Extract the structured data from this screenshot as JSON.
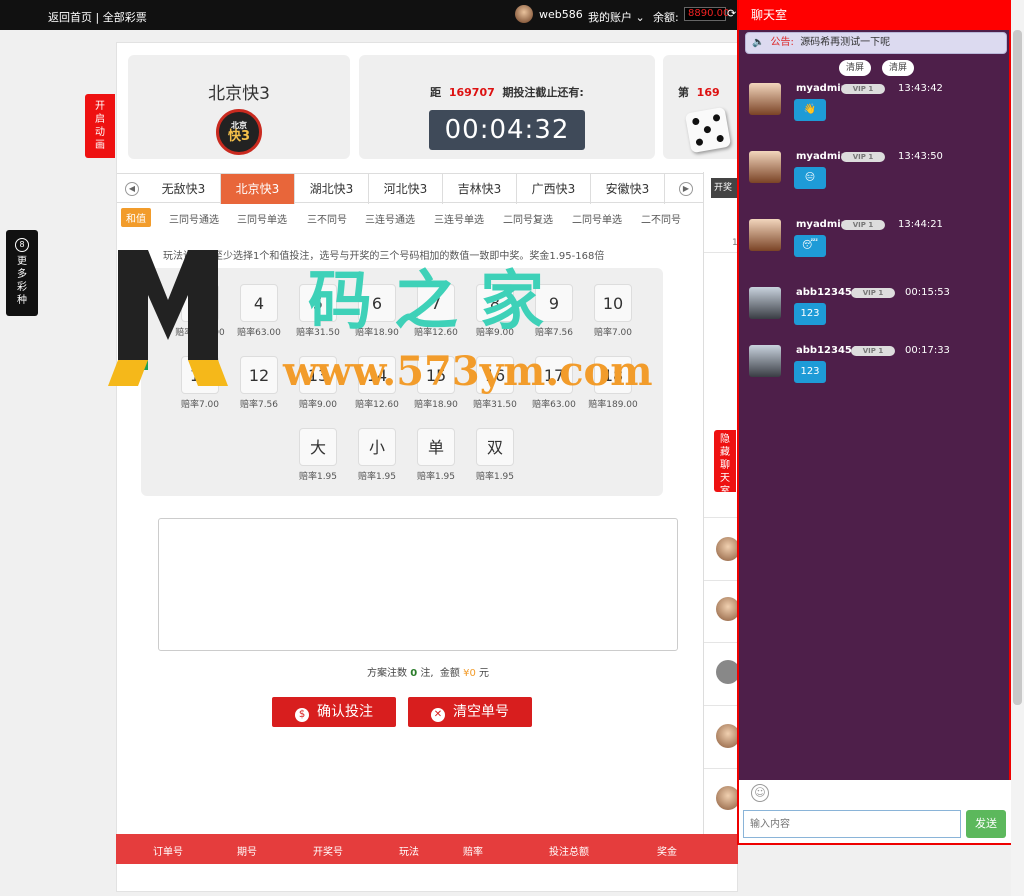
{
  "topbar": {
    "home": "返回首页",
    "all": "全部彩票",
    "user": "web586",
    "account": "我的账户",
    "balance_label": "余额:",
    "balance": "8890.00"
  },
  "sidebar": {
    "more_icon": "8",
    "more": "更多彩种",
    "open_anim": "开启动画",
    "hide_chat": "隐藏聊天室"
  },
  "game": {
    "name": "北京快3",
    "logo_top": "北京",
    "logo_bottom": "快3",
    "period_prefix": "距",
    "period": "169707",
    "period_suffix": "期投注截止还有:",
    "timer": "00:04:32",
    "next_prefix": "第",
    "next_period": "169"
  },
  "tabs": [
    "无敌快3",
    "北京快3",
    "湖北快3",
    "河北快3",
    "吉林快3",
    "广西快3",
    "安徽快3"
  ],
  "subtabs": [
    "和值",
    "三同号通选",
    "三同号单选",
    "三不同号",
    "三连号通选",
    "三连号单选",
    "二同号复选",
    "二同号单选",
    "二不同号"
  ],
  "description": "玩法说明：至少选择1个和值投注，选号与开奖的三个号码相加的数值一致即中奖。奖金1.95-168倍",
  "numbers_row1": [
    {
      "n": "3",
      "o": "赔率189.00"
    },
    {
      "n": "4",
      "o": "赔率63.00"
    },
    {
      "n": "5",
      "o": "赔率31.50"
    },
    {
      "n": "6",
      "o": "赔率18.90"
    },
    {
      "n": "7",
      "o": "赔率12.60"
    },
    {
      "n": "8",
      "o": "赔率9.00"
    },
    {
      "n": "9",
      "o": "赔率7.56"
    },
    {
      "n": "10",
      "o": "赔率7.00"
    }
  ],
  "numbers_row2": [
    {
      "n": "11",
      "o": "赔率7.00"
    },
    {
      "n": "12",
      "o": "赔率7.56"
    },
    {
      "n": "13",
      "o": "赔率9.00"
    },
    {
      "n": "14",
      "o": "赔率12.60"
    },
    {
      "n": "15",
      "o": "赔率18.90"
    },
    {
      "n": "16",
      "o": "赔率31.50"
    },
    {
      "n": "17",
      "o": "赔率63.00"
    },
    {
      "n": "18",
      "o": "赔率189.00"
    }
  ],
  "numbers_row3": [
    {
      "n": "大",
      "o": "赔率1.95"
    },
    {
      "n": "小",
      "o": "赔率1.95"
    },
    {
      "n": "单",
      "o": "赔率1.95"
    },
    {
      "n": "双",
      "o": "赔率1.95"
    }
  ],
  "summary": {
    "prefix": "方案注数",
    "count": "0",
    "unit": "注,",
    "amount_label": "金额",
    "amount": "¥0",
    "amount_unit": "元"
  },
  "buttons": {
    "confirm": "确认投注",
    "clear": "清空单号"
  },
  "footer": [
    "订单号",
    "期号",
    "开奖号",
    "玩法",
    "赔率",
    "投注总额",
    "奖金"
  ],
  "right": {
    "kaijiang": "开奖",
    "row": "1-"
  },
  "chat": {
    "title": "聊天室",
    "notice_label": "公告:",
    "notice": "源码希再测试一下呢",
    "clear1": "清屏",
    "clear2": "清屏",
    "vip": "VIP 1",
    "input_placeholder": "输入内容",
    "send": "发送",
    "messages": [
      {
        "user": "myadmin",
        "time": "13:43:42",
        "content": "👋",
        "avatar": "female"
      },
      {
        "user": "myadmin",
        "time": "13:43:50",
        "content": "😑",
        "avatar": "female"
      },
      {
        "user": "myadmin",
        "time": "13:44:21",
        "content": "😴",
        "avatar": "female"
      },
      {
        "user": "abb123456",
        "time": "00:15:53",
        "content": "123",
        "avatar": "male"
      },
      {
        "user": "abb123456",
        "time": "00:17:33",
        "content": "123",
        "avatar": "male"
      }
    ]
  },
  "watermark": {
    "cn": "码之家",
    "url": "www.573ym.com"
  }
}
